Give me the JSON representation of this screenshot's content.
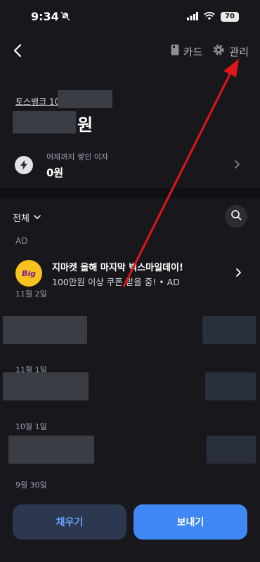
{
  "status": {
    "time": "9:34",
    "battery": "70"
  },
  "nav": {
    "card_label": "카드",
    "manage_label": "관리"
  },
  "account": {
    "name": "토스뱅크 10",
    "balance_unit": "원"
  },
  "interest": {
    "label": "어제까지 쌓인 이자",
    "value": "0원"
  },
  "filter": {
    "label": "전체"
  },
  "ad": {
    "section_label": "AD",
    "logo_text": "Big",
    "title": "지마켓 올해 마지막 빅스마일데이!",
    "subtitle": "100만원 이상 쿠폰 받을 중! • AD"
  },
  "dates": [
    "11월 2일",
    "11월 1일",
    "10월 1일",
    "9월 30일"
  ],
  "buttons": {
    "fill": "채우기",
    "send": "보내기"
  },
  "colors": {
    "background": "#17171c",
    "accent_blue": "#3f87f5",
    "annotation_red": "#e0141b"
  }
}
